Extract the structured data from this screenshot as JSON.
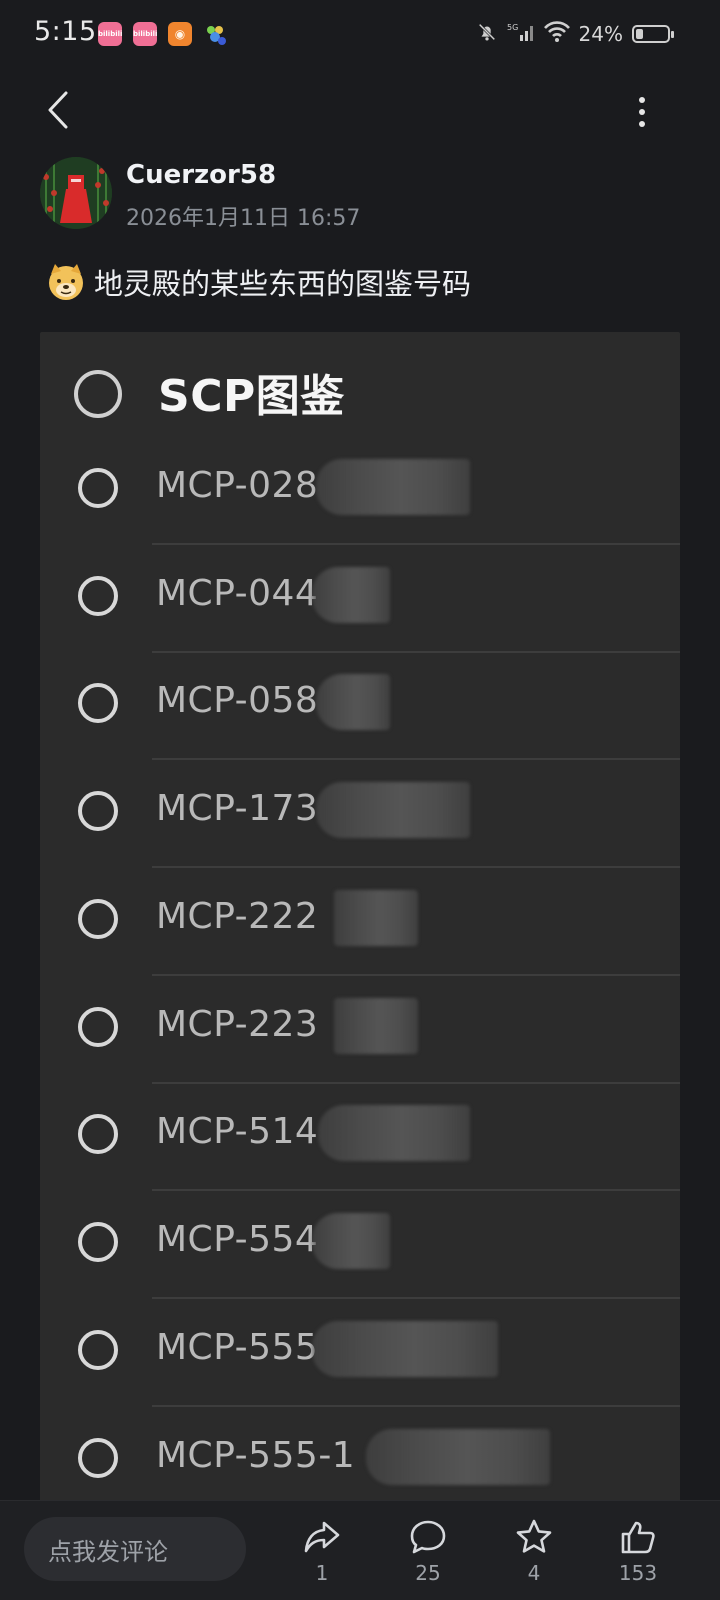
{
  "status_bar": {
    "time": "5:15",
    "battery_percent": "24%",
    "battery_level": 0.24,
    "signal": "5G",
    "apps": [
      {
        "name": "bilibili",
        "label": "bilibili"
      },
      {
        "name": "bilibili",
        "label": "bilibili"
      },
      {
        "name": "app",
        "label": "◉"
      },
      {
        "name": "game",
        "label": ""
      }
    ]
  },
  "post": {
    "author": "Cuerzor58",
    "time": "2026年1月11日 16:57",
    "title": "地灵殿的某些东西的图鉴号码",
    "emoji_icon": "doge-emoji-icon"
  },
  "image": {
    "header": "SCP图鉴",
    "entries": [
      {
        "code": "MCP-028"
      },
      {
        "code": "MCP-044"
      },
      {
        "code": "MCP-058"
      },
      {
        "code": "MCP-173"
      },
      {
        "code": "MCP-222"
      },
      {
        "code": "MCP-223"
      },
      {
        "code": "MCP-514"
      },
      {
        "code": "MCP-554"
      },
      {
        "code": "MCP-555"
      },
      {
        "code": "MCP-555-1"
      }
    ]
  },
  "bottom_bar": {
    "comment_placeholder": "点我发评论",
    "share_count": "1",
    "comment_count": "25",
    "favorite_count": "4",
    "like_count": "153"
  },
  "colors": {
    "background": "#1a1b1e",
    "card": "#2b2b2b",
    "muted_text": "#8a8f96"
  }
}
